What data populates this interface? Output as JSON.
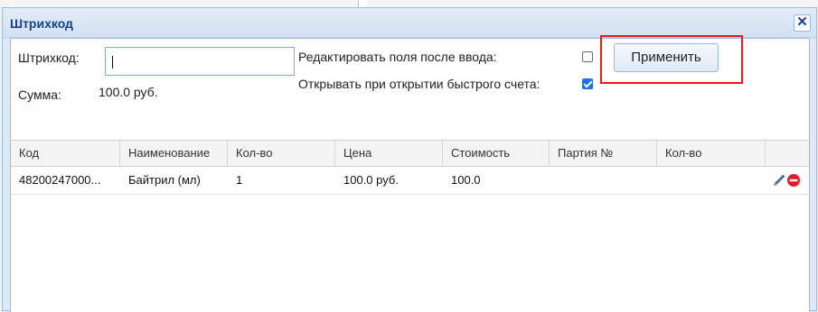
{
  "window": {
    "title": "Штрихкод",
    "close_label": "✕"
  },
  "form": {
    "barcode_label": "Штрихкод:",
    "barcode_value": "",
    "sum_label": "Сумма:",
    "sum_value": "100.0 руб.",
    "edit_fields_label": "Редактировать поля после ввода:",
    "edit_fields_checked": false,
    "open_quick_label": "Открывать при открытии быстрого счета:",
    "open_quick_checked": true,
    "apply_label": "Применить"
  },
  "grid": {
    "columns": [
      "Код",
      "Наименование",
      "Кол-во",
      "Цена",
      "Стоимость",
      "Партия №",
      "Кол-во",
      ""
    ],
    "rows": [
      {
        "code": "48200247000...",
        "name": "Байтрил (мл)",
        "qty": "1",
        "price": "100.0 руб.",
        "cost": "100.0",
        "batch": "",
        "batch_qty": ""
      }
    ]
  },
  "colors": {
    "accent": "#15428b",
    "highlight": "#e8191b",
    "checkbox": "#1a73e8"
  },
  "icons": {
    "close": "close-icon",
    "edit": "pencil-icon",
    "delete": "remove-circle-icon"
  }
}
